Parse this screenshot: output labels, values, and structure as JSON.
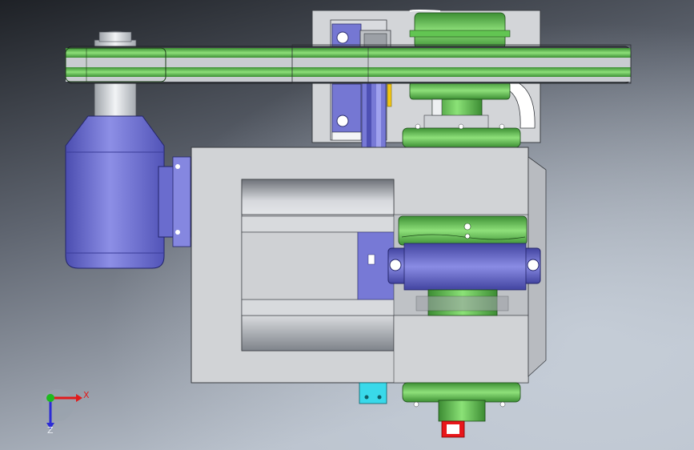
{
  "viewport": {
    "background_top": "#25282d",
    "background_bottom": "#aeb6c2",
    "colors": {
      "green": "#5fbf4f",
      "green_dark": "#2f7d2a",
      "green_light": "#86d873",
      "gray": "#cdd0d4",
      "gray_dark": "#8e939a",
      "blue": "#6d6fcf",
      "blue_dark": "#3f4198",
      "cyan": "#39d9ea",
      "red": "#e8161a"
    }
  },
  "triad": {
    "x_label": "X",
    "y_label": "Y",
    "z_label": "Z",
    "x_color": "#e21b1b",
    "y_color": "#1dbb1d",
    "z_color": "#2b2bd6"
  }
}
